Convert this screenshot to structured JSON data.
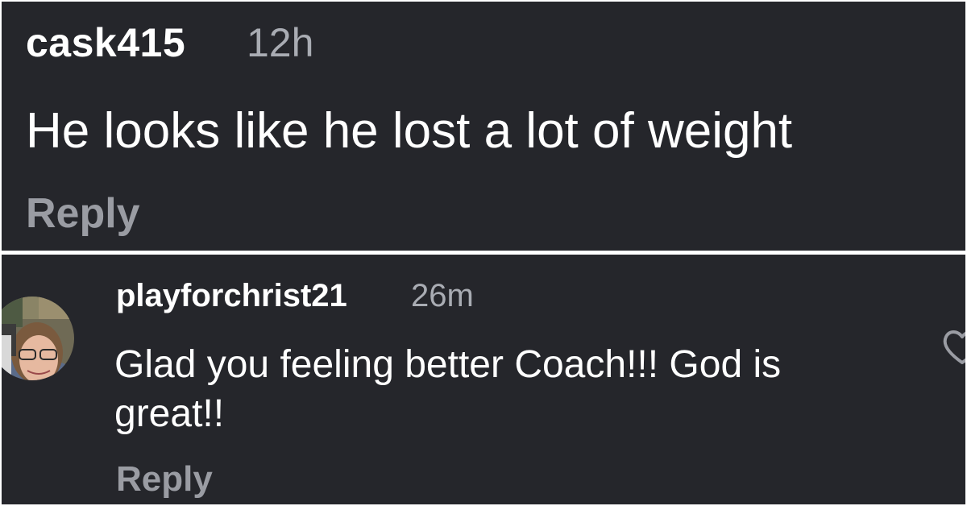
{
  "comments": [
    {
      "username": "cask415",
      "timestamp": "12h",
      "text": "He looks like he lost a lot of weight",
      "reply_label": "Reply"
    },
    {
      "username": "playforchrist21",
      "timestamp": "26m",
      "text": "Glad you feeling better Coach!!! God is great!!",
      "reply_label": "Reply",
      "avatar": "user-photo-avatar",
      "like_icon": "heart-outline-icon"
    }
  ],
  "colors": {
    "background": "#25262b",
    "text": "#ffffff",
    "muted": "#a9acb3"
  }
}
